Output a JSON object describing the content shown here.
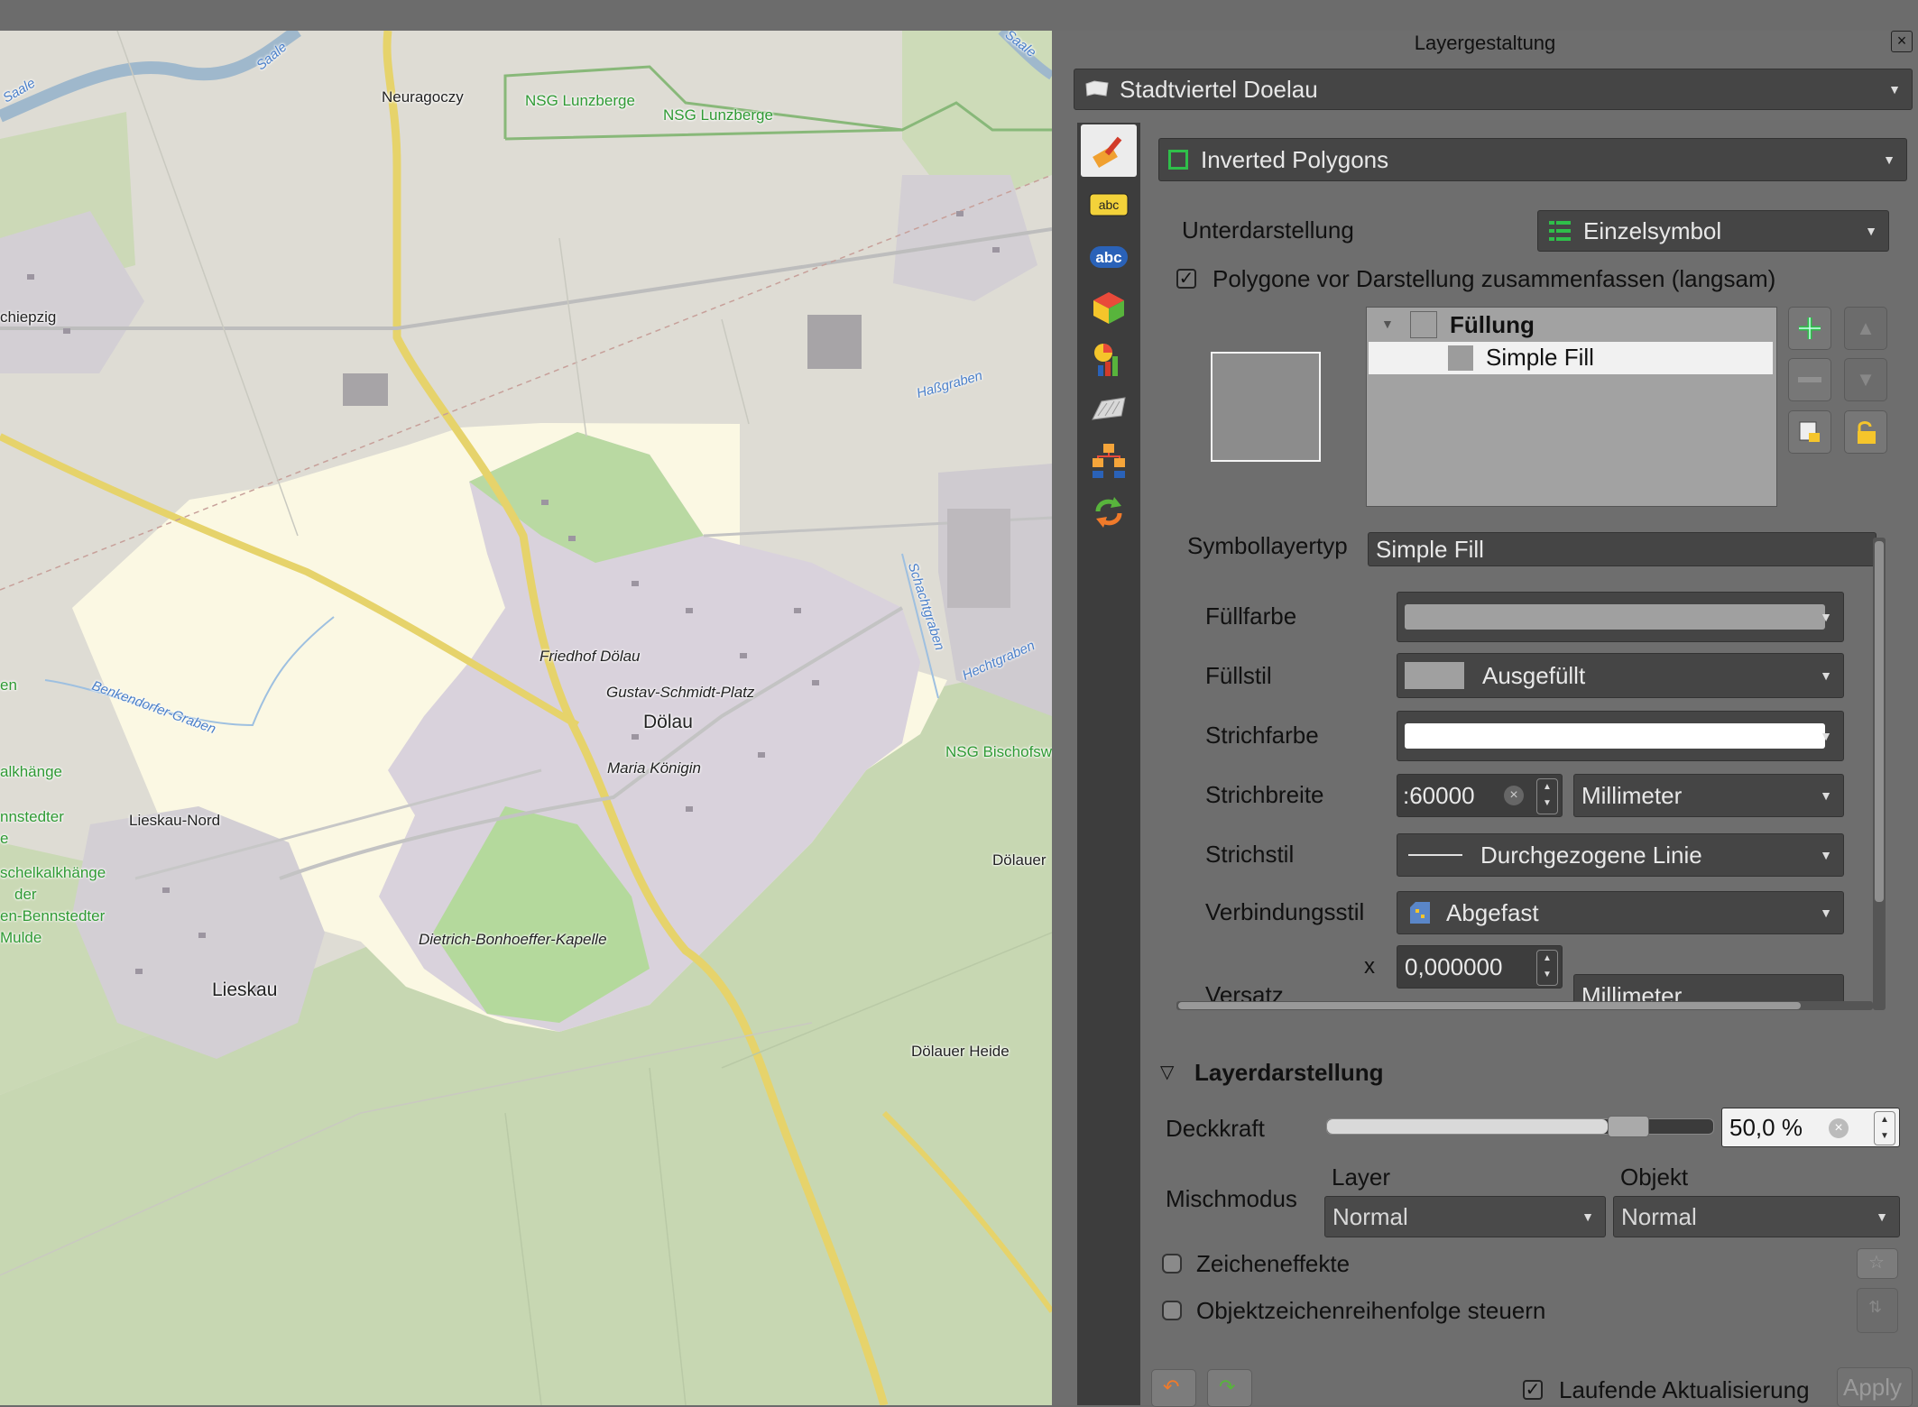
{
  "map": {
    "labels": {
      "neuragoczy": "Neuragoczy",
      "nsg_lunzberge_1": "NSG Lunzberge",
      "nsg_lunzberge_2": "NSG Lunzberge",
      "saale_1": "Saale",
      "saale_2": "Saale",
      "saale_3": "Saale",
      "schiepzig": "chiepzig",
      "hassgraben": "Haßgraben",
      "schachtgraben": "Schachtgraben",
      "hechtgraben": "Hechtgraben",
      "benkendorfer_graben": "Benkendorfer-Graben",
      "friedhof": "Friedhof Dölau",
      "gustav": "Gustav-Schmidt-Platz",
      "doelau": "Dölau",
      "maria": "Maria Königin",
      "nsg_bischofs": "NSG Bischofsw",
      "kalkhaenge": "alkhänge",
      "nnstedter": "nnstedter",
      "e": "e",
      "schelkalkhaenge": "schelkalkhänge",
      "der": "der",
      "en_bennstedter": "en-Bennstedter",
      "mulde": "Mulde",
      "lieskau_nord": "Lieskau-Nord",
      "lieskau": "Lieskau",
      "doelauer": "Dölauer",
      "bonhoeffer": "Dietrich-Bonhoeffer-Kapelle",
      "doelauer_heide": "Dölauer Heide",
      "en": "en"
    }
  },
  "panel": {
    "title": "Layergestaltung",
    "layer_name": "Stadtviertel Doelau",
    "renderer": "Inverted Polygons",
    "sub_renderer_label": "Unterdarstellung",
    "sub_renderer_value": "Einzelsymbol",
    "merge_checkbox_label": "Polygone vor Darstellung zusammenfassen (langsam)",
    "tree": {
      "parent": "Füllung",
      "child": "Simple Fill"
    },
    "symbol_layer_type_label": "Symbollayertyp",
    "symbol_layer_type_value": "Simple Fill",
    "props": {
      "fill_color_label": "Füllfarbe",
      "fill_style_label": "Füllstil",
      "fill_style_value": "Ausgefüllt",
      "stroke_color_label": "Strichfarbe",
      "stroke_width_label": "Strichbreite",
      "stroke_width_value": ":60000",
      "stroke_width_unit": "Millimeter",
      "stroke_style_label": "Strichstil",
      "stroke_style_value": "Durchgezogene Linie",
      "join_style_label": "Verbindungsstil",
      "join_style_value": "Abgefast",
      "offset_x_label": "x",
      "offset_x_value": "0,000000",
      "offset_label": "Versatz",
      "offset_unit": "Millimeter"
    },
    "layer_rendering": {
      "header": "Layerdarstellung",
      "opacity_label": "Deckkraft",
      "opacity_value": "50,0 %",
      "opacity": 0.5,
      "blend_label": "Mischmodus",
      "blend_layer_label": "Layer",
      "blend_object_label": "Objekt",
      "blend_layer_value": "Normal",
      "blend_object_value": "Normal",
      "effects_label": "Zeicheneffekte",
      "order_label": "Objektzeichenreihenfolge steuern"
    },
    "footer": {
      "live_update_label": "Laufende Aktualisierung",
      "apply_label": "Apply"
    },
    "colors": {
      "fill": "#a0a0a0",
      "stroke": "#ffffff",
      "panel_bg": "#6e6e6e",
      "sidebar_bg": "#3d3d3d"
    },
    "icons": [
      "paintbrush-icon",
      "label-abc-yellow-icon",
      "label-abc-white-icon",
      "3d-cube-icon",
      "diagram-icon",
      "fields-icon",
      "hierarchy-icon",
      "history-icon"
    ]
  }
}
